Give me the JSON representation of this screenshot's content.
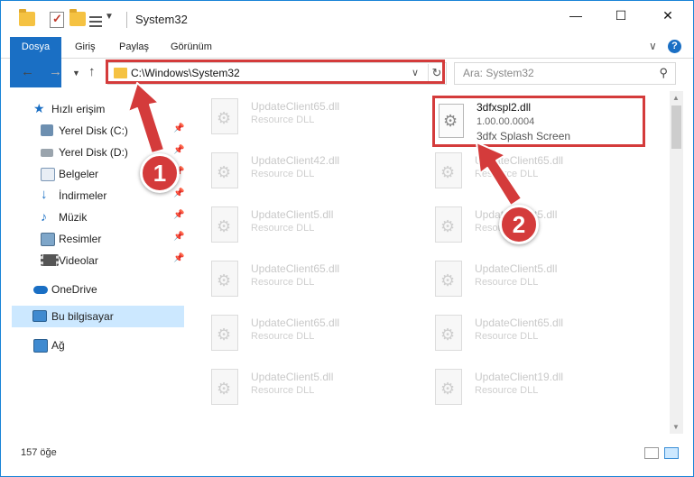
{
  "window": {
    "title": "System32",
    "minimize_glyph": "—",
    "maximize_glyph": "☐",
    "close_glyph": "✕"
  },
  "ribbon": {
    "tabs": [
      "Dosya",
      "Giriş",
      "Paylaş",
      "Görünüm"
    ],
    "expand_glyph": "∨",
    "help_glyph": "?"
  },
  "address": {
    "path": "C:\\Windows\\System32",
    "search_placeholder": "Ara: System32"
  },
  "sidebar": {
    "items": [
      {
        "label": "Hızlı erişim",
        "icon": "star-icon",
        "pinned": false,
        "level": 0
      },
      {
        "label": "Yerel Disk (C:)",
        "icon": "windows-drive-icon",
        "pinned": true,
        "level": 1
      },
      {
        "label": "Yerel Disk (D:)",
        "icon": "drive-icon",
        "pinned": true,
        "level": 1
      },
      {
        "label": "Belgeler",
        "icon": "documents-icon",
        "pinned": true,
        "level": 1
      },
      {
        "label": "İndirmeler",
        "icon": "download-icon",
        "pinned": true,
        "level": 1
      },
      {
        "label": "Müzik",
        "icon": "music-icon",
        "pinned": true,
        "level": 1
      },
      {
        "label": "Resimler",
        "icon": "pictures-icon",
        "pinned": true,
        "level": 1
      },
      {
        "label": "Videolar",
        "icon": "videos-icon",
        "pinned": true,
        "level": 1
      },
      {
        "label": "OneDrive",
        "icon": "cloud-icon",
        "pinned": false,
        "level": 0
      },
      {
        "label": "Bu bilgisayar",
        "icon": "computer-icon",
        "pinned": false,
        "level": 0,
        "selected": true
      },
      {
        "label": "Ağ",
        "icon": "network-icon",
        "pinned": false,
        "level": 0
      }
    ]
  },
  "files": {
    "featured": {
      "name": "3dfxspl2.dll",
      "version": "1.00.00.0004",
      "description": "3dfx Splash Screen"
    },
    "left_column": [
      {
        "name": "UpdateClient65.dll",
        "desc": "Resource DLL"
      },
      {
        "name": "UpdateClient42.dll",
        "desc": "Resource DLL"
      },
      {
        "name": "UpdateClient5.dll",
        "desc": "Resource DLL"
      },
      {
        "name": "UpdateClient65.dll",
        "desc": "Resource DLL"
      },
      {
        "name": "UpdateClient65.dll",
        "desc": "Resource DLL"
      },
      {
        "name": "UpdateClient5.dll",
        "desc": "Resource DLL"
      }
    ],
    "right_column": [
      {
        "name": "UpdateClient65.dll",
        "desc": "Resource DLL"
      },
      {
        "name": "UpdateClient5.dll",
        "desc": "Resource DLL"
      },
      {
        "name": "UpdateClient5.dll",
        "desc": "Resource DLL"
      },
      {
        "name": "UpdateClient65.dll",
        "desc": "Resource DLL"
      },
      {
        "name": "UpdateClient19.dll",
        "desc": "Resource DLL"
      }
    ]
  },
  "status": {
    "item_count": "157 öğe"
  },
  "annotations": {
    "step1": "1",
    "step2": "2",
    "color": "#d43b3b"
  },
  "colors": {
    "accent": "#1a6fc4",
    "selection": "#cce8ff",
    "highlight": "#d43b3b"
  }
}
